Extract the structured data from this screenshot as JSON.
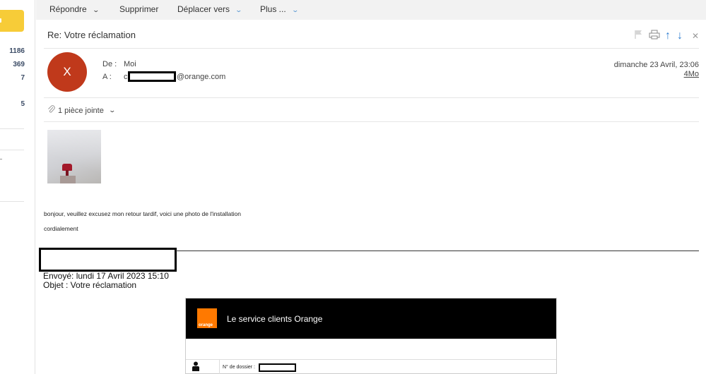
{
  "sidebar": {
    "counts": [
      "1186",
      "369",
      "7",
      "5"
    ]
  },
  "toolbar": {
    "reply_label": "Répondre",
    "delete_label": "Supprimer",
    "move_label": "Déplacer vers",
    "more_label": "Plus ..."
  },
  "message": {
    "subject": "Re: Votre réclamation",
    "avatar_letter": "X",
    "from_label": "De :",
    "from_value": "Moi",
    "to_label": "A :",
    "to_prefix": "c",
    "to_suffix": "@orange.com",
    "date": "dimanche 23 Avril, 23:06",
    "size": "4Mo",
    "attachment_label": "1 pièce jointe",
    "body_line1": "bonjour, veuillez excusez mon retour tardif, voici une photo de l'installation",
    "body_line2": "cordialement",
    "sent": "Envoyé: lundi 17 Avril 2023 15:10",
    "object": "Objet : Votre réclamation"
  },
  "orange_block": {
    "logo_text": "orange",
    "title": "Le service clients Orange",
    "dossier_label": "N° de dossier :"
  },
  "colors": {
    "accent_yellow": "#f7cc38",
    "avatar": "#c0391b",
    "orange_brand": "#ff7900",
    "arrow_blue": "#2f7fd1"
  }
}
